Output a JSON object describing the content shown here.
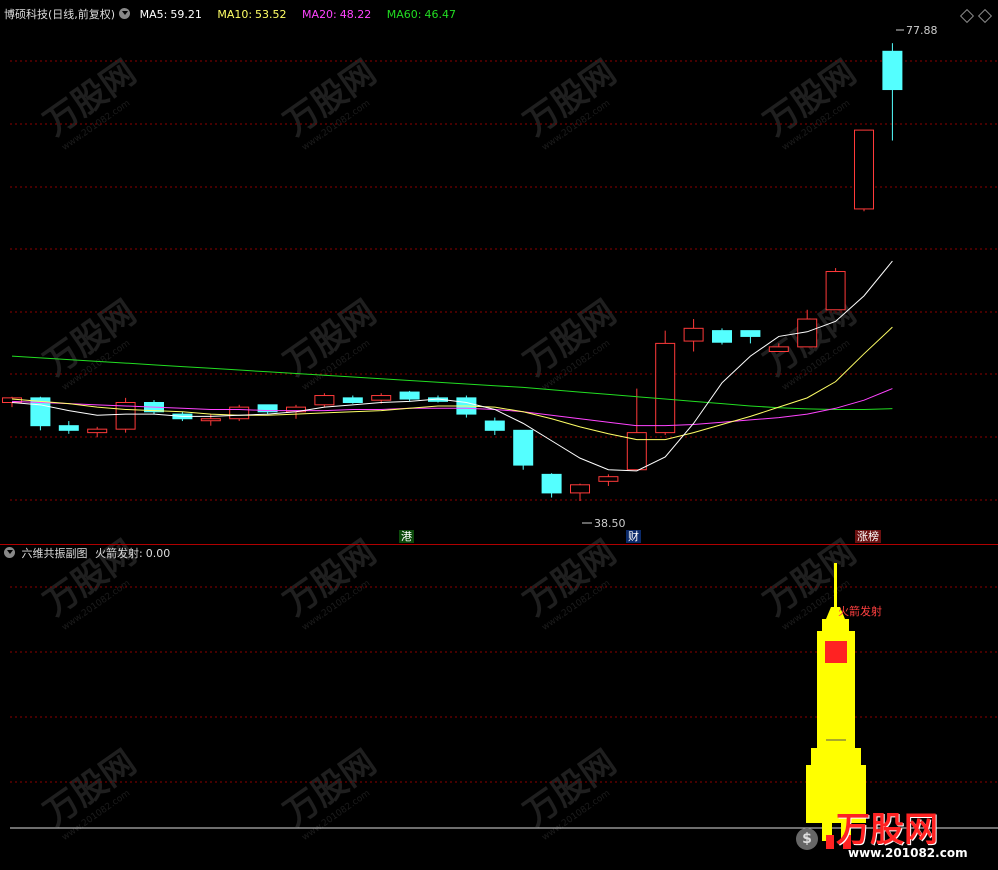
{
  "main_panel": {
    "stock_title": "博硕科技(日线,前复权)",
    "ma5": {
      "label": "MA5:",
      "value": "59.21",
      "color": "#ffffff"
    },
    "ma10": {
      "label": "MA10:",
      "value": "53.52",
      "color": "#ffff66"
    },
    "ma20": {
      "label": "MA20:",
      "value": "48.22",
      "color": "#ff44ff"
    },
    "ma60": {
      "label": "MA60:",
      "value": "46.47",
      "color": "#22dd22"
    },
    "high_label": "77.88",
    "low_label": "38.50",
    "event_tags": [
      "港",
      "财",
      "涨榜"
    ]
  },
  "sub_panel": {
    "indicator_title": "六维共振副图",
    "signal_label": "火箭发射:",
    "signal_value": "0.00",
    "rocket_label": "火箭发射"
  },
  "watermark": {
    "brand": "万股网",
    "url": "www.201082.com"
  },
  "colors": {
    "up": "#ff3a3a",
    "down": "#54ffff",
    "grid": "#8b0000",
    "rocket": "#ffff00"
  },
  "chart_data": {
    "type": "candlestick",
    "ylim": [
      36,
      80
    ],
    "candles": [
      {
        "o": 47.0,
        "h": 47.5,
        "l": 46.6,
        "c": 47.4
      },
      {
        "o": 47.4,
        "h": 47.5,
        "l": 44.6,
        "c": 45.0
      },
      {
        "o": 45.0,
        "h": 45.4,
        "l": 44.3,
        "c": 44.6
      },
      {
        "o": 44.4,
        "h": 44.9,
        "l": 44.0,
        "c": 44.7
      },
      {
        "o": 44.7,
        "h": 47.4,
        "l": 44.4,
        "c": 47.0
      },
      {
        "o": 47.0,
        "h": 47.2,
        "l": 46.0,
        "c": 46.2
      },
      {
        "o": 46.0,
        "h": 46.2,
        "l": 45.4,
        "c": 45.6
      },
      {
        "o": 45.6,
        "h": 46.0,
        "l": 45.0,
        "c": 45.6
      },
      {
        "o": 45.6,
        "h": 46.8,
        "l": 45.4,
        "c": 46.6
      },
      {
        "o": 46.8,
        "h": 46.8,
        "l": 46.0,
        "c": 46.2
      },
      {
        "o": 46.2,
        "h": 46.8,
        "l": 45.6,
        "c": 46.6
      },
      {
        "o": 46.8,
        "h": 47.8,
        "l": 46.6,
        "c": 47.6
      },
      {
        "o": 47.4,
        "h": 47.6,
        "l": 46.9,
        "c": 47.0
      },
      {
        "o": 47.2,
        "h": 47.8,
        "l": 46.9,
        "c": 47.6
      },
      {
        "o": 47.9,
        "h": 48.0,
        "l": 47.1,
        "c": 47.3
      },
      {
        "o": 47.4,
        "h": 47.6,
        "l": 47.0,
        "c": 47.1
      },
      {
        "o": 47.4,
        "h": 47.6,
        "l": 45.7,
        "c": 46.0
      },
      {
        "o": 45.4,
        "h": 45.7,
        "l": 44.2,
        "c": 44.6
      },
      {
        "o": 44.6,
        "h": 44.6,
        "l": 41.2,
        "c": 41.6
      },
      {
        "o": 40.8,
        "h": 40.9,
        "l": 38.8,
        "c": 39.2
      },
      {
        "o": 39.2,
        "h": 40.0,
        "l": 38.5,
        "c": 39.9
      },
      {
        "o": 40.2,
        "h": 40.8,
        "l": 39.8,
        "c": 40.6
      },
      {
        "o": 41.2,
        "h": 48.2,
        "l": 41.2,
        "c": 44.4
      },
      {
        "o": 44.4,
        "h": 53.2,
        "l": 44.2,
        "c": 52.1
      },
      {
        "o": 52.3,
        "h": 54.2,
        "l": 51.4,
        "c": 53.4
      },
      {
        "o": 53.2,
        "h": 53.4,
        "l": 52.0,
        "c": 52.2
      },
      {
        "o": 53.2,
        "h": 53.2,
        "l": 52.1,
        "c": 52.7
      },
      {
        "o": 51.4,
        "h": 52.1,
        "l": 51.4,
        "c": 51.8
      },
      {
        "o": 51.8,
        "h": 55.0,
        "l": 51.8,
        "c": 54.2
      },
      {
        "o": 55.0,
        "h": 58.6,
        "l": 55.0,
        "c": 58.3
      },
      {
        "o": 63.7,
        "h": 70.5,
        "l": 63.5,
        "c": 70.5
      },
      {
        "o": 77.3,
        "h": 78.0,
        "l": 69.6,
        "c": 74.0
      }
    ],
    "ma5": [
      47.0,
      46.8,
      46.3,
      45.9,
      46.0,
      46.0,
      45.8,
      45.8,
      45.9,
      46.0,
      46.2,
      46.6,
      46.8,
      47.0,
      47.1,
      47.3,
      47.0,
      46.4,
      45.2,
      43.7,
      42.2,
      41.2,
      41.1,
      42.3,
      45.2,
      48.7,
      51.0,
      52.7,
      53.1,
      54.0,
      56.2,
      59.2
    ],
    "ma10": [
      47.3,
      47.1,
      46.9,
      46.6,
      46.4,
      46.3,
      46.2,
      46.0,
      45.9,
      45.9,
      46.0,
      46.1,
      46.2,
      46.3,
      46.5,
      46.7,
      46.7,
      46.6,
      46.2,
      45.6,
      44.9,
      44.3,
      43.8,
      43.8,
      44.4,
      45.1,
      45.8,
      46.6,
      47.4,
      48.8,
      51.2,
      53.5
    ],
    "ma20": [
      47.1,
      47.0,
      46.9,
      46.8,
      46.7,
      46.6,
      46.5,
      46.4,
      46.4,
      46.3,
      46.3,
      46.3,
      46.4,
      46.4,
      46.5,
      46.5,
      46.5,
      46.4,
      46.2,
      45.9,
      45.6,
      45.3,
      45.0,
      45.0,
      45.1,
      45.3,
      45.5,
      45.7,
      46.0,
      46.5,
      47.2,
      48.2
    ],
    "ma60": [
      51.0,
      50.85,
      50.7,
      50.55,
      50.4,
      50.25,
      50.1,
      49.95,
      49.8,
      49.65,
      49.5,
      49.35,
      49.2,
      49.05,
      48.9,
      48.75,
      48.6,
      48.45,
      48.3,
      48.1,
      47.9,
      47.7,
      47.5,
      47.3,
      47.1,
      46.9,
      46.7,
      46.55,
      46.45,
      46.4,
      46.4,
      46.47
    ]
  }
}
